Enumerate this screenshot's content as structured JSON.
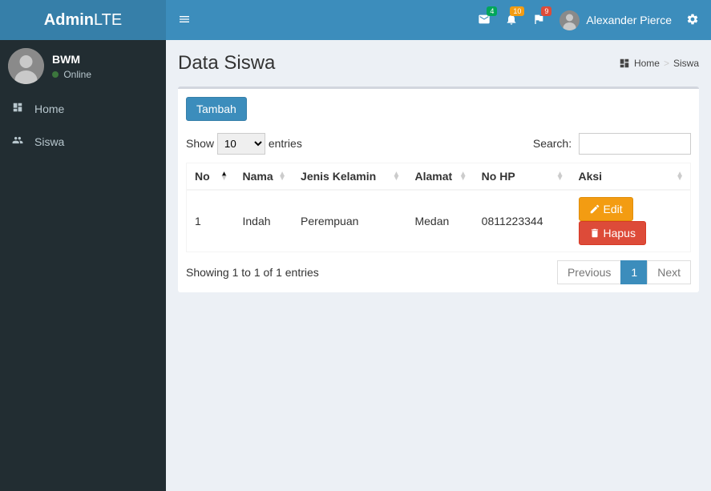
{
  "logo": {
    "bold": "Admin",
    "light": "LTE"
  },
  "sidebar_user": {
    "name": "BWM",
    "status": "Online"
  },
  "sidebar_menu": [
    {
      "label": "Home"
    },
    {
      "label": "Siswa"
    }
  ],
  "navbar": {
    "badges": {
      "mail": "4",
      "bell": "10",
      "flag": "9"
    },
    "username": "Alexander Pierce"
  },
  "page": {
    "title": "Data Siswa",
    "breadcrumb_home": "Home",
    "breadcrumb_current": "Siswa"
  },
  "actions": {
    "add_label": "Tambah",
    "edit_label": "Edit",
    "delete_label": "Hapus"
  },
  "datatable": {
    "length_prefix": "Show",
    "length_value": "10",
    "length_suffix": "entries",
    "search_label": "Search:",
    "columns": {
      "no": "No",
      "nama": "Nama",
      "jenis_kelamin": "Jenis Kelamin",
      "alamat": "Alamat",
      "no_hp": "No HP",
      "aksi": "Aksi"
    },
    "rows": [
      {
        "no": "1",
        "nama": "Indah",
        "jenis_kelamin": "Perempuan",
        "alamat": "Medan",
        "no_hp": "0811223344"
      }
    ],
    "info": "Showing 1 to 1 of 1 entries",
    "paginate": {
      "previous": "Previous",
      "page": "1",
      "next": "Next"
    }
  }
}
